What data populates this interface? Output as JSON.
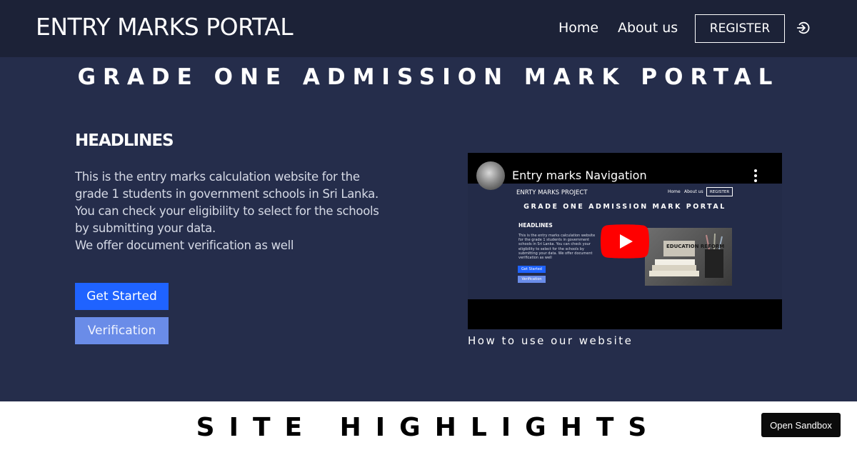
{
  "nav": {
    "brand": "ENTRY MARKS PORTAL",
    "home": "Home",
    "about": "About us",
    "register": "REGISTER",
    "login_icon": "login-icon"
  },
  "hero": {
    "title": "GRADE ONE ADMISSION MARK PORTAL",
    "headlines": "HEADLINES",
    "lines": [
      "This is the entry marks calculation website for the grade 1 students in government schools in Sri Lanka.",
      "You can check your eligibility to select for the schools by submitting your data.",
      "We offer document verification as well"
    ],
    "get_started": "Get Started",
    "verification": "Verification"
  },
  "video": {
    "title": "Entry marks Navigation",
    "caption": "How to use our website",
    "thumb": {
      "brand": "ENRTY MARKS PROJECT",
      "nav_home": "Home",
      "nav_about": "About us",
      "nav_register": "REGISTER",
      "title": "GRADE ONE ADMISSION MARK PORTAL",
      "headlines": "HEADLINES",
      "text": "This is the entry marks calculation website for the grade 1 students in government schools in Sri Lanka. You can check your eligibility to select for the schools by submitting your data. We offer document verification as well",
      "btn1": "Get Started",
      "btn2": "Verification",
      "image_text": "EDUCATION REFORM"
    }
  },
  "highlights": {
    "title": "SITE HIGHLIGHTS"
  },
  "sandbox": {
    "label": "Open Sandbox"
  },
  "colors": {
    "navbar": "#1c2237",
    "hero": "#252d4b",
    "primary_button": "#1f63ff",
    "secondary_button": "#6a8ce8",
    "youtube_red": "#ff0000"
  }
}
